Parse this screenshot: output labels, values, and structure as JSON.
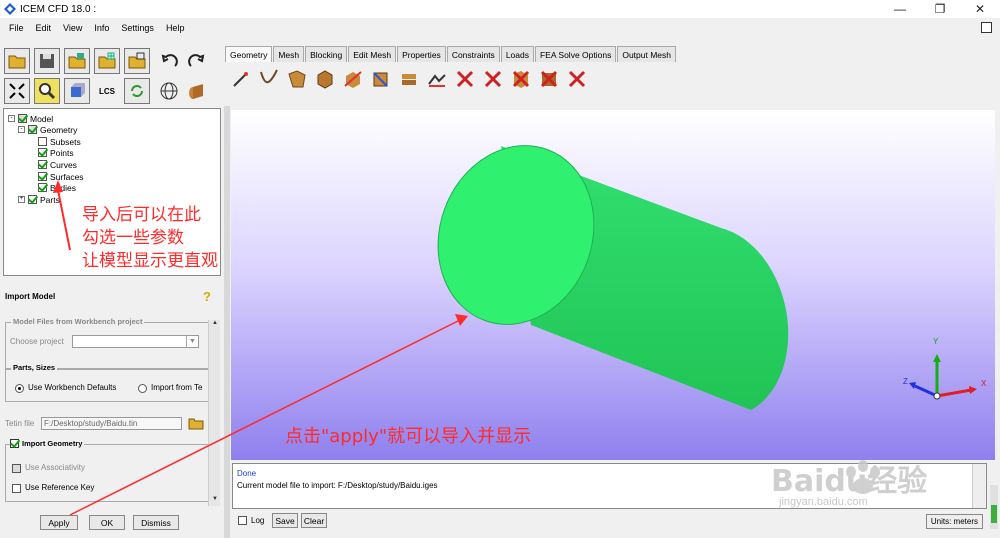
{
  "window": {
    "title": "ICEM CFD 18.0 :"
  },
  "menu": [
    "File",
    "Edit",
    "View",
    "Info",
    "Settings",
    "Help"
  ],
  "toolbar": {
    "lcs_label": "LCS"
  },
  "tabs": [
    "Geometry",
    "Mesh",
    "Blocking",
    "Edit Mesh",
    "Properties",
    "Constraints",
    "Loads",
    "FEA Solve Options",
    "Output Mesh"
  ],
  "tree": {
    "model": "Model",
    "geometry": "Geometry",
    "subsets": "Subsets",
    "points": "Points",
    "curves": "Curves",
    "surfaces": "Surfaces",
    "bodies": "Bodies",
    "parts": "Parts"
  },
  "import_panel": {
    "title": "Import Model",
    "wb_group": "Model Files from Workbench project",
    "choose_project": "Choose project",
    "parts_group": "Parts, Sizes",
    "use_wb_defaults": "Use Workbench Defaults",
    "import_from": "Import from Te",
    "tetin_label": "Tetin file",
    "tetin_value": "F:/Desktop/study/Baidu.tin",
    "import_geometry": "Import Geometry",
    "use_associativity": "Use Associativity",
    "use_reference_key": "Use Reference Key"
  },
  "buttons": {
    "apply": "Apply",
    "ok": "OK",
    "dismiss": "Dismiss",
    "save": "Save",
    "clear": "Clear",
    "log": "Log"
  },
  "console": {
    "line1": "Done",
    "line2": "Current model file to import: F:/Desktop/study/Baidu.iges"
  },
  "units": "Units: meters",
  "axes": {
    "x": "X",
    "y": "Y",
    "z": "Z"
  },
  "annotations": {
    "note1_line1": "导入后可以在此",
    "note1_line2": "勾选一些参数",
    "note1_line3": "让模型显示更直观",
    "note2": "点击\"apply\"就可以导入并显示"
  },
  "watermark": {
    "brand": "Baidu经验",
    "url": "jingyan.baidu.com"
  },
  "colors": {
    "cylinder": "#2fe06a",
    "viewport_bottom": "#8f80ee",
    "annotation": "#ff2b2b"
  }
}
